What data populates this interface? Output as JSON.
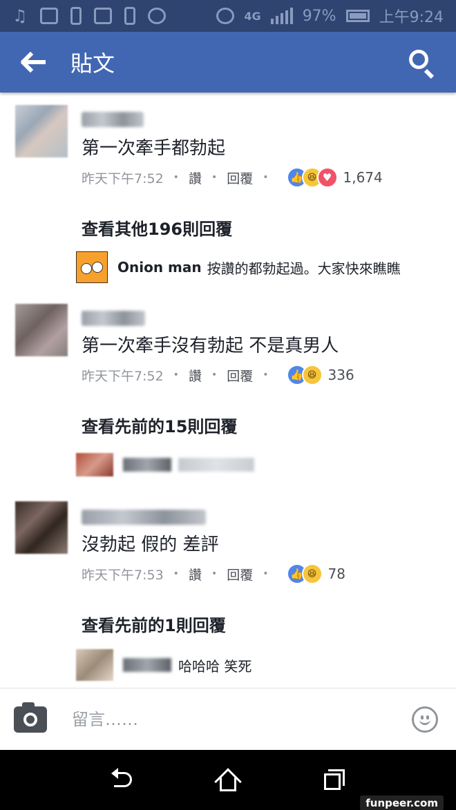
{
  "status_bar": {
    "network": "4G",
    "battery": "97%",
    "time": "上午9:24"
  },
  "app_bar": {
    "title": "貼文"
  },
  "comments": [
    {
      "text": "第一次牽手都勃起",
      "timestamp": "昨天下午7:52",
      "like_label": "讚",
      "reply_label": "回覆",
      "reactions": [
        "like",
        "haha",
        "love"
      ],
      "reaction_count": "1,674",
      "view_more": "查看其他196則回覆",
      "reply": {
        "name": "Onion man",
        "text": "按讚的都勃起過。大家快來瞧瞧"
      }
    },
    {
      "text": "第一次牽手沒有勃起 不是真男人",
      "timestamp": "昨天下午7:52",
      "like_label": "讚",
      "reply_label": "回覆",
      "reactions": [
        "like",
        "haha"
      ],
      "reaction_count": "336",
      "view_more": "查看先前的15則回覆"
    },
    {
      "text": "沒勃起 假的 差評",
      "timestamp": "昨天下午7:53",
      "like_label": "讚",
      "reply_label": "回覆",
      "reactions": [
        "like",
        "haha"
      ],
      "reaction_count": "78",
      "view_more": "查看先前的1則回覆",
      "reply": {
        "text": "哈哈哈 笑死"
      }
    }
  ],
  "composer": {
    "placeholder": "留言……"
  },
  "watermark": "funpeer.com",
  "colors": {
    "status_bar": "#2f4470",
    "app_bar": "#4267b2",
    "like": "#4e86ec",
    "haha": "#f7c53a",
    "love": "#f25268"
  },
  "icons": [
    "back-arrow-icon",
    "search-icon",
    "camera-icon",
    "smiley-icon",
    "nav-back-icon",
    "nav-home-icon",
    "nav-recent-icon"
  ]
}
